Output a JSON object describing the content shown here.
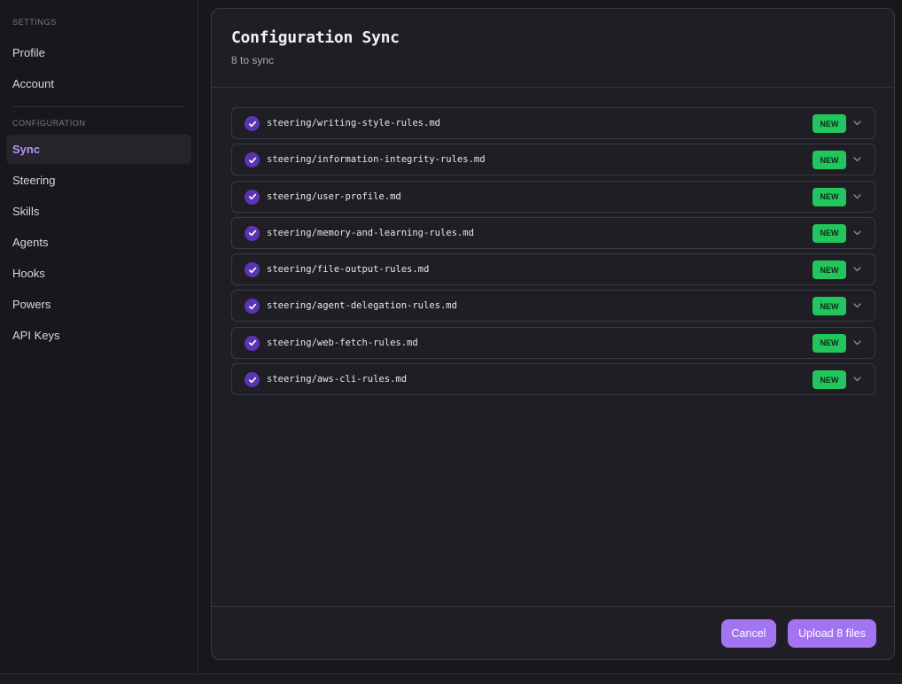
{
  "sidebar": {
    "sections": [
      {
        "label": "SETTINGS",
        "items": [
          {
            "label": "Profile"
          },
          {
            "label": "Account"
          }
        ]
      },
      {
        "label": "CONFIGURATION",
        "items": [
          {
            "label": "Sync",
            "active": true
          },
          {
            "label": "Steering"
          },
          {
            "label": "Skills"
          },
          {
            "label": "Agents"
          },
          {
            "label": "Hooks"
          },
          {
            "label": "Powers"
          },
          {
            "label": "API Keys"
          }
        ]
      }
    ]
  },
  "panel": {
    "title": "Configuration Sync",
    "subtitle": "8 to sync",
    "files": [
      {
        "path": "steering/writing-style-rules.md",
        "badge": "NEW",
        "checked": true
      },
      {
        "path": "steering/information-integrity-rules.md",
        "badge": "NEW",
        "checked": true
      },
      {
        "path": "steering/user-profile.md",
        "badge": "NEW",
        "checked": true
      },
      {
        "path": "steering/memory-and-learning-rules.md",
        "badge": "NEW",
        "checked": true
      },
      {
        "path": "steering/file-output-rules.md",
        "badge": "NEW",
        "checked": true
      },
      {
        "path": "steering/agent-delegation-rules.md",
        "badge": "NEW",
        "checked": true
      },
      {
        "path": "steering/web-fetch-rules.md",
        "badge": "NEW",
        "checked": true
      },
      {
        "path": "steering/aws-cli-rules.md",
        "badge": "NEW",
        "checked": true
      }
    ],
    "cancel_label": "Cancel",
    "upload_label": "Upload 8 files"
  },
  "colors": {
    "accent": "#a374f2",
    "active_nav": "#b794f6",
    "check": "#5b34b4",
    "badge_new": "#22c55e"
  },
  "icons": {
    "check": "checkmark-icon",
    "expand": "chevron-down-icon"
  }
}
